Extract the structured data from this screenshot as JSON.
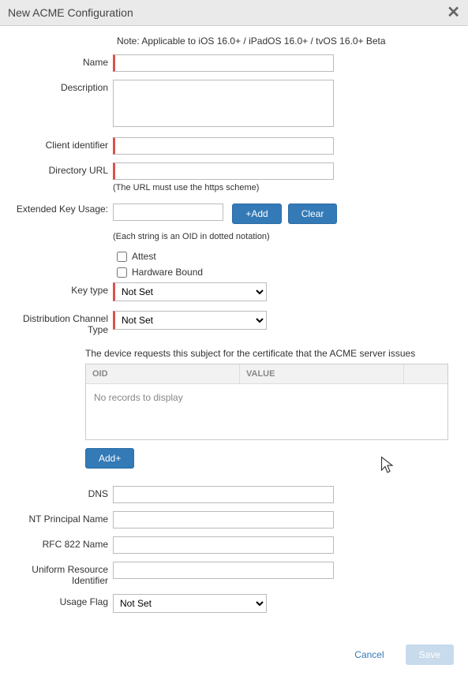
{
  "dialog": {
    "title": "New ACME Configuration",
    "note": "Note: Applicable to iOS 16.0+ / iPadOS 16.0+ / tvOS 16.0+ Beta"
  },
  "labels": {
    "name": "Name",
    "description": "Description",
    "client_identifier": "Client identifier",
    "directory_url": "Directory URL",
    "directory_url_hint": "(The URL must use the https scheme)",
    "extended_key_usage": "Extended Key Usage:",
    "eku_hint": "(Each string is an OID in dotted notation)",
    "attest": "Attest",
    "hardware_bound": "Hardware Bound",
    "key_type": "Key type",
    "distribution_channel_type": "Distribution Channel Type",
    "subject_note": "The device requests this subject for the certificate that the ACME server issues",
    "dns": "DNS",
    "nt_principal_name": "NT Principal Name",
    "rfc822_name": "RFC 822 Name",
    "uri": "Uniform Resource Identifier",
    "usage_flag": "Usage Flag"
  },
  "table": {
    "col_oid": "OID",
    "col_value": "VALUE",
    "empty": "No records to display"
  },
  "selects": {
    "not_set": "Not Set"
  },
  "buttons": {
    "add": "+Add",
    "clear": "Clear",
    "add_plus": "Add+",
    "cancel": "Cancel",
    "save": "Save"
  },
  "values": {
    "name": "",
    "description": "",
    "client_identifier": "",
    "directory_url": "",
    "eku_input": "",
    "attest": false,
    "hardware_bound": false,
    "key_type": "Not Set",
    "distribution_channel_type": "Not Set",
    "dns": "",
    "nt_principal_name": "",
    "rfc822": "",
    "uri": "",
    "usage_flag": "Not Set"
  }
}
